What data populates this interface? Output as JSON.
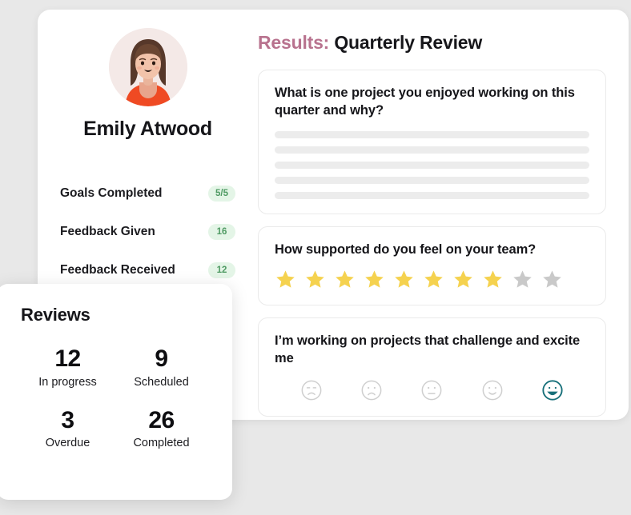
{
  "colors": {
    "background": "#e8e8e8",
    "panel": "#ffffff",
    "accent_pink": "#b8728e",
    "badge_bg": "#e4f5e7",
    "badge_text": "#4f9a63",
    "star_filled": "#f5d24f",
    "star_empty": "#c9c9c9",
    "face_selected": "#17707a",
    "face_empty": "#cfcfcf",
    "skeleton": "#ececec"
  },
  "profile": {
    "avatar_icon": "user-avatar-illustration",
    "name": "Emily Atwood",
    "stats": [
      {
        "label": "Goals Completed",
        "value": "5/5"
      },
      {
        "label": "Feedback Given",
        "value": "16"
      },
      {
        "label": "Feedback Received",
        "value": "12"
      }
    ]
  },
  "results": {
    "title_prefix": "Results:",
    "title_main": "Quarterly Review",
    "cards": [
      {
        "type": "open-text",
        "question": "What is one project you enjoyed working on this quarter and why?",
        "skeleton_lines": 5
      },
      {
        "type": "star-rating",
        "question": "How supported do you feel on your team?",
        "stars_total": 10,
        "stars_filled": 8
      },
      {
        "type": "emoji-scale",
        "question": "I’m working on projects that challenge and excite me",
        "faces_total": 5,
        "face_selected_index": 4,
        "face_names": [
          "face-very-unhappy-icon",
          "face-unhappy-icon",
          "face-neutral-icon",
          "face-happy-icon",
          "face-very-happy-icon"
        ]
      }
    ]
  },
  "reviews": {
    "title": "Reviews",
    "items": [
      {
        "value": "12",
        "label": "In progress"
      },
      {
        "value": "9",
        "label": "Scheduled"
      },
      {
        "value": "3",
        "label": "Overdue"
      },
      {
        "value": "26",
        "label": "Completed"
      }
    ]
  }
}
